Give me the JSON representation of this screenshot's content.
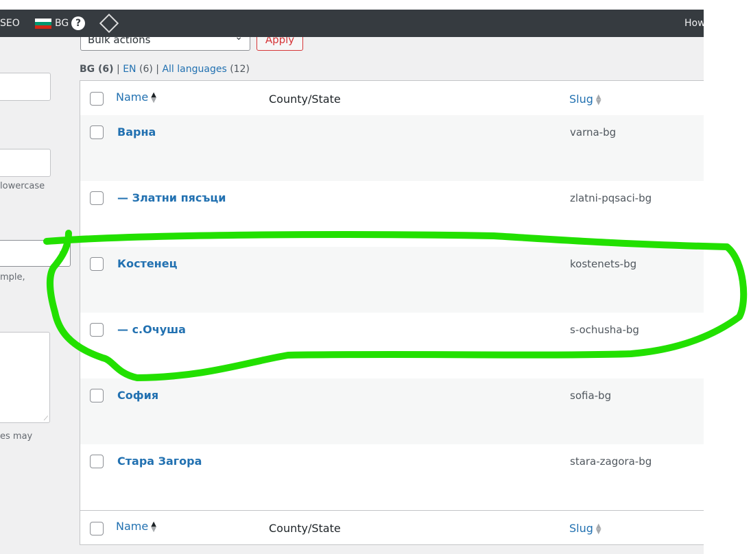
{
  "adminbar": {
    "seo": "SEO",
    "lang": "BG",
    "help": "?",
    "howdy": "How"
  },
  "colors": {
    "flag": [
      "#ffffff",
      "#00966e",
      "#d62612"
    ],
    "annotation": "#22e000"
  },
  "left_form": {
    "help1": "lowercase",
    "help2": "mple,",
    "help3": "es may"
  },
  "toolbar": {
    "bulk_actions": "Bulk actions",
    "apply": "Apply"
  },
  "languages": {
    "bg": "BG (6)",
    "sep": "|",
    "en": "EN",
    "en_count": "(6)",
    "all": "All languages",
    "all_count": "(12)"
  },
  "table": {
    "columns": {
      "name": "Name",
      "county": "County/State",
      "slug": "Slug"
    },
    "rows": [
      {
        "name": "Варна",
        "slug": "varna-bg"
      },
      {
        "name": "— Златни пясъци",
        "slug": "zlatni-pqsaci-bg"
      },
      {
        "name": "Костенец",
        "slug": "kostenets-bg"
      },
      {
        "name": "— с.Очуша",
        "slug": "s-ochusha-bg"
      },
      {
        "name": "София",
        "slug": "sofia-bg"
      },
      {
        "name": "Стара Загора",
        "slug": "stara-zagora-bg"
      }
    ]
  }
}
